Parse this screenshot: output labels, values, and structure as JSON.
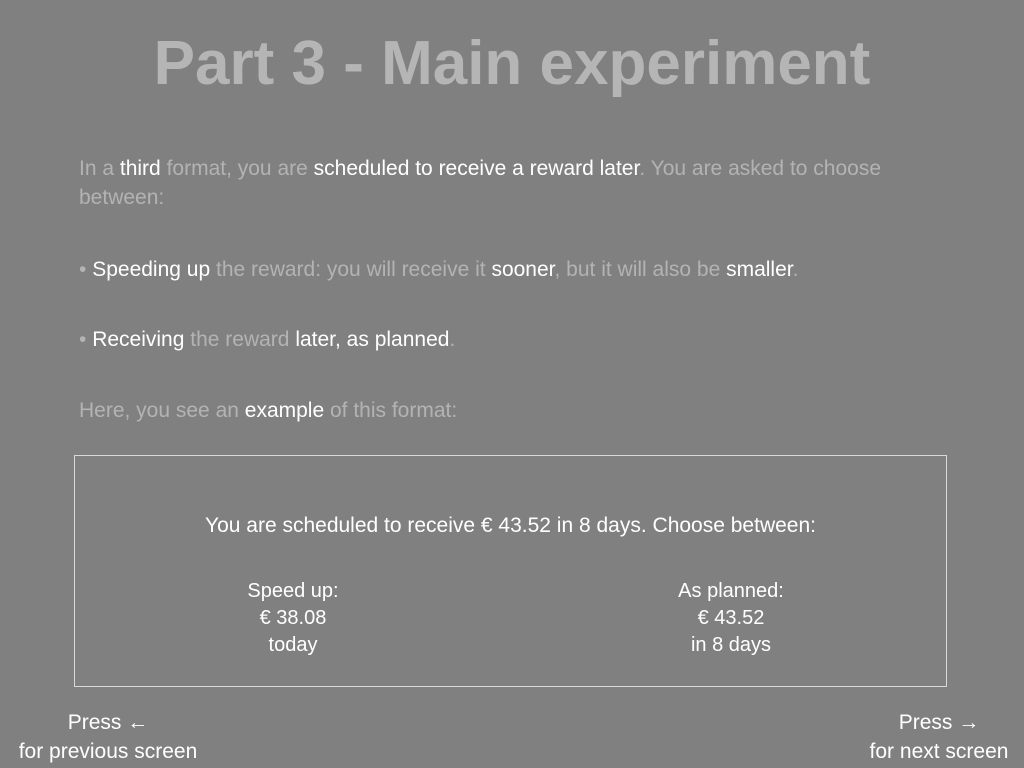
{
  "title": "Part 3 - Main experiment",
  "intro": {
    "p1": "In a ",
    "h1": "third",
    "p2": " format, you are ",
    "h2": "scheduled to receive a reward later",
    "p3": ". You are asked to choose between:"
  },
  "bullet1": {
    "dot": "•",
    "h1": "Speeding up",
    "p1": " the reward: you will receive it ",
    "h2": "sooner",
    "p2": ", but it will also be ",
    "h3": "smaller",
    "p3": "."
  },
  "bullet2": {
    "dot": "•",
    "h1": "Receiving",
    "p1": " the reward ",
    "h2": "later, as planned",
    "p2": "."
  },
  "example_intro": {
    "p1": "Here, you see an ",
    "h1": "example",
    "p2": " of this format:"
  },
  "example": {
    "prompt": "You are scheduled to receive € 43.52 in 8 days. Choose between:",
    "option_left": {
      "label": "Speed up:",
      "amount": "€ 38.08",
      "when": "today"
    },
    "option_right": {
      "label": "As planned:",
      "amount": "€ 43.52",
      "when": "in 8 days"
    }
  },
  "nav": {
    "prev_line1": "Press ←",
    "prev_line2": "for previous screen",
    "next_line1": "Press →",
    "next_line2": "for next screen"
  },
  "colors": {
    "background": "#808080",
    "highlight": "#ffffff",
    "muted": "#b3b3b3"
  }
}
